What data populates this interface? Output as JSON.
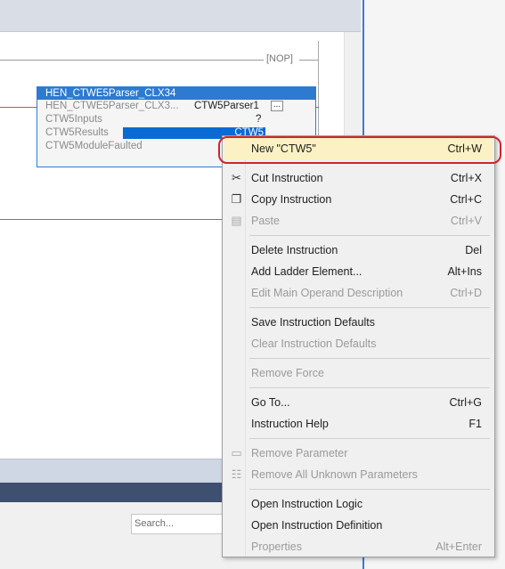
{
  "ladder": {
    "nop_label": "[NOP]",
    "aoi": {
      "title": "HEN_CTWE5Parser_CLX34",
      "instance_label": "HEN_CTWE5Parser_CLX3...",
      "instance_value": "CTW5Parser1",
      "ellipsis": "...",
      "inputs_label": "CTW5Inputs",
      "inputs_value": "?",
      "results_label": "CTW5Results",
      "results_value": "CTW5",
      "faulted_label": "CTW5ModuleFaulted"
    }
  },
  "bottom": {
    "search_placeholder": "Search..."
  },
  "context_menu": {
    "new": {
      "label": "New \"CTW5\"",
      "shortcut": "Ctrl+W"
    },
    "cut": {
      "label": "Cut Instruction",
      "shortcut": "Ctrl+X"
    },
    "copy": {
      "label": "Copy Instruction",
      "shortcut": "Ctrl+C"
    },
    "paste": {
      "label": "Paste",
      "shortcut": "Ctrl+V"
    },
    "delete": {
      "label": "Delete Instruction",
      "shortcut": "Del"
    },
    "add_ladder": {
      "label": "Add Ladder Element...",
      "shortcut": "Alt+Ins"
    },
    "edit_main_operand": {
      "label": "Edit Main Operand Description",
      "shortcut": "Ctrl+D"
    },
    "save_defaults": {
      "label": "Save Instruction Defaults",
      "shortcut": ""
    },
    "clear_defaults": {
      "label": "Clear Instruction Defaults",
      "shortcut": ""
    },
    "remove_force": {
      "label": "Remove Force",
      "shortcut": ""
    },
    "go_to": {
      "label": "Go To...",
      "shortcut": "Ctrl+G"
    },
    "instruction_help": {
      "label": "Instruction Help",
      "shortcut": "F1"
    },
    "remove_parameter": {
      "label": "Remove Parameter",
      "shortcut": ""
    },
    "remove_all_unknown": {
      "label": "Remove All Unknown Parameters",
      "shortcut": ""
    },
    "open_logic": {
      "label": "Open Instruction Logic",
      "shortcut": ""
    },
    "open_definition": {
      "label": "Open Instruction Definition",
      "shortcut": ""
    },
    "properties": {
      "label": "Properties",
      "shortcut": "Alt+Enter"
    }
  },
  "colors": {
    "accent": "#2d7bd1",
    "selection": "#0a6ad4",
    "highlight": "#fbf1c2",
    "annotation": "#d2232a"
  }
}
